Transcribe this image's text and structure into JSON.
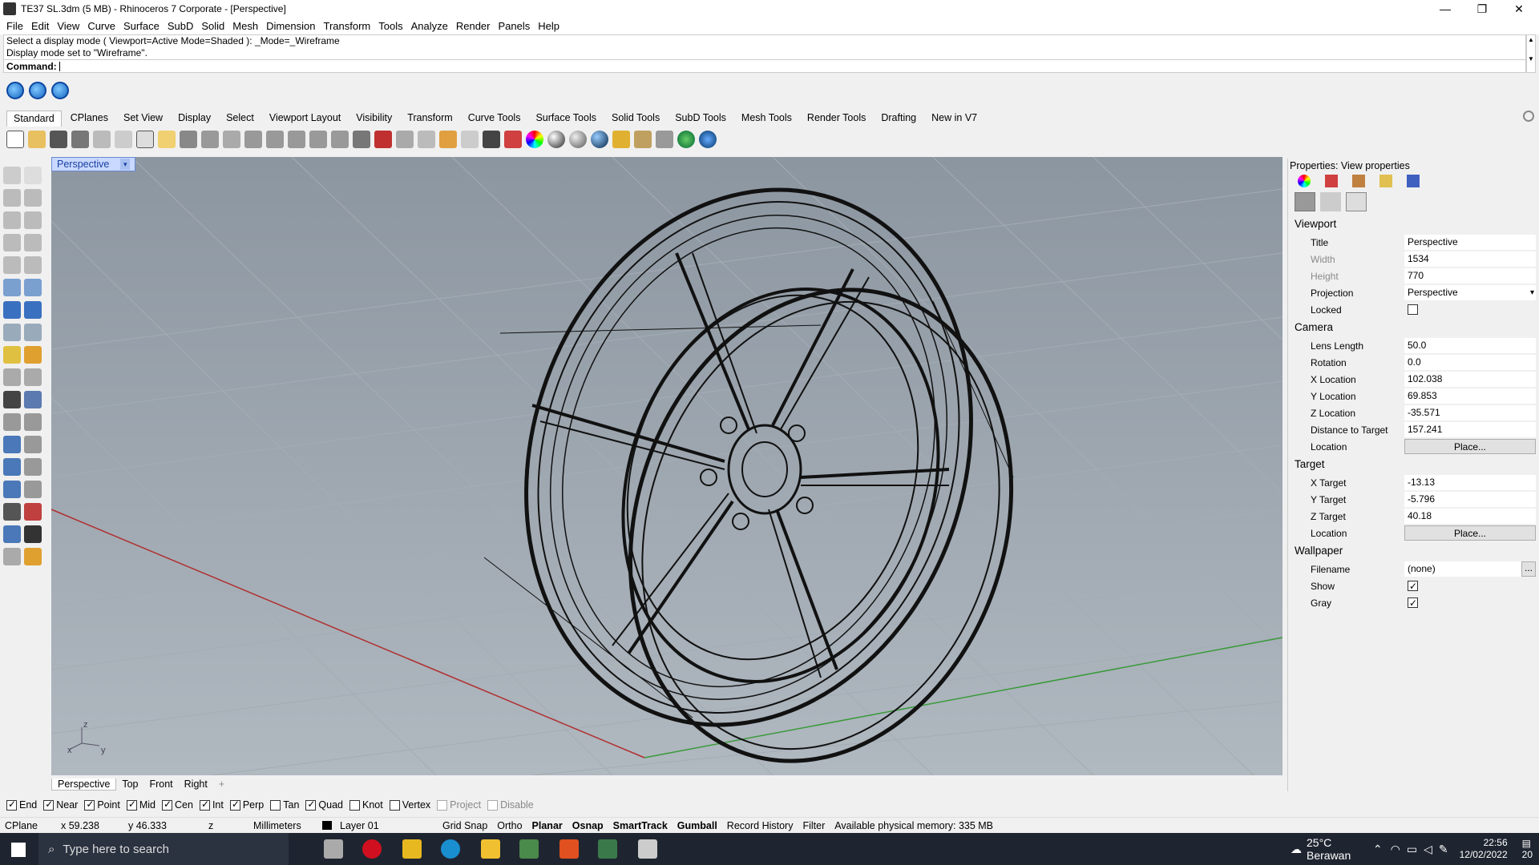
{
  "window": {
    "title": "TE37 SL.3dm (5 MB) - Rhinoceros 7 Corporate - [Perspective]",
    "controls": [
      "—",
      "❐",
      "✕"
    ]
  },
  "menu": [
    "File",
    "Edit",
    "View",
    "Curve",
    "Surface",
    "SubD",
    "Solid",
    "Mesh",
    "Dimension",
    "Transform",
    "Tools",
    "Analyze",
    "Render",
    "Panels",
    "Help"
  ],
  "command_history": [
    "Select a display mode ( Viewport=Active  Mode=Shaded ): _Mode=_Wireframe",
    "Display mode set to \"Wireframe\"."
  ],
  "command_label": "Command:",
  "toolbar_tabs": [
    "Standard",
    "CPlanes",
    "Set View",
    "Display",
    "Select",
    "Viewport Layout",
    "Visibility",
    "Transform",
    "Curve Tools",
    "Surface Tools",
    "Solid Tools",
    "SubD Tools",
    "Mesh Tools",
    "Render Tools",
    "Drafting",
    "New in V7"
  ],
  "viewport": {
    "title": "Perspective",
    "dropdown": "▾",
    "axis_labels": {
      "z": "z",
      "x": "x",
      "y": "y"
    },
    "tabs": [
      "Perspective",
      "Top",
      "Front",
      "Right"
    ],
    "add_tab": "+"
  },
  "properties": {
    "header": "Properties: View properties",
    "viewport_section": "Viewport",
    "rows_viewport": [
      {
        "k": "Title",
        "v": "Perspective"
      },
      {
        "k": "Width",
        "v": "1534"
      },
      {
        "k": "Height",
        "v": "770"
      },
      {
        "k": "Projection",
        "v": "Perspective"
      },
      {
        "k": "Locked",
        "v": ""
      }
    ],
    "camera_section": "Camera",
    "rows_camera": [
      {
        "k": "Lens Length",
        "v": "50.0"
      },
      {
        "k": "Rotation",
        "v": "0.0"
      },
      {
        "k": "X Location",
        "v": "102.038"
      },
      {
        "k": "Y Location",
        "v": "69.853"
      },
      {
        "k": "Z Location",
        "v": "-35.571"
      },
      {
        "k": "Distance to Target",
        "v": "157.241"
      },
      {
        "k": "Location",
        "v": "Place..."
      }
    ],
    "target_section": "Target",
    "rows_target": [
      {
        "k": "X Target",
        "v": "-13.13"
      },
      {
        "k": "Y Target",
        "v": "-5.796"
      },
      {
        "k": "Z Target",
        "v": "40.18"
      },
      {
        "k": "Location",
        "v": "Place..."
      }
    ],
    "wallpaper_section": "Wallpaper",
    "rows_wallpaper": [
      {
        "k": "Filename",
        "v": "(none)"
      },
      {
        "k": "Show",
        "v": ""
      },
      {
        "k": "Gray",
        "v": ""
      }
    ],
    "browse": "..."
  },
  "osnaps": [
    {
      "label": "End",
      "on": true
    },
    {
      "label": "Near",
      "on": true
    },
    {
      "label": "Point",
      "on": true
    },
    {
      "label": "Mid",
      "on": true
    },
    {
      "label": "Cen",
      "on": true
    },
    {
      "label": "Int",
      "on": true
    },
    {
      "label": "Perp",
      "on": true
    },
    {
      "label": "Tan",
      "on": false
    },
    {
      "label": "Quad",
      "on": true
    },
    {
      "label": "Knot",
      "on": false
    },
    {
      "label": "Vertex",
      "on": false
    },
    {
      "label": "Project",
      "on": false
    },
    {
      "label": "Disable",
      "on": false
    }
  ],
  "status": {
    "cplane": "CPlane",
    "x": "x 59.238",
    "y": "y 46.333",
    "z": "z",
    "units": "Millimeters",
    "layer": "Layer 01",
    "toggles": [
      "Grid Snap",
      "Ortho",
      "Planar",
      "Osnap",
      "SmartTrack",
      "Gumball",
      "Record History",
      "Filter"
    ],
    "memory": "Available physical memory: 335 MB"
  },
  "taskbar": {
    "search": "Type here to search",
    "weather": "25°C  Berawan",
    "time": "22:56",
    "date": "12/02/2022",
    "notif": "20"
  },
  "colors": {
    "x_axis": "#b03030",
    "y_axis": "#3a9a3a",
    "viewport_bg": "#9aa3ad"
  }
}
